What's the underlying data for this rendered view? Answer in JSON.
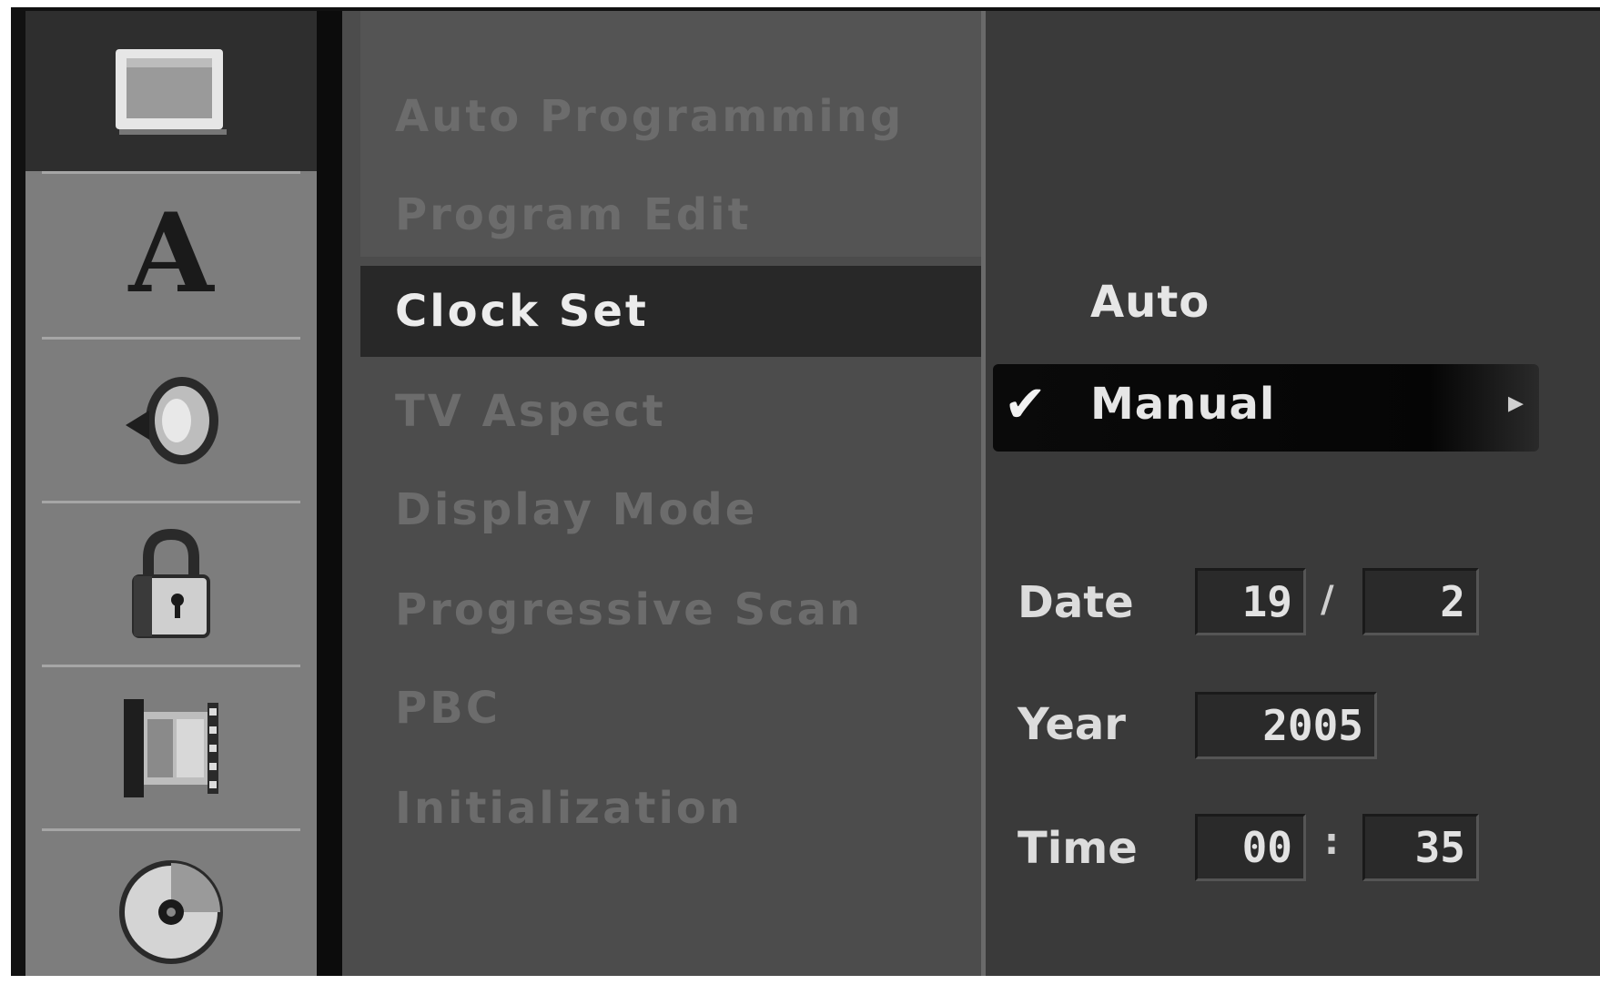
{
  "sidebar": {
    "icons": [
      {
        "name": "tv-screen-icon",
        "active": true
      },
      {
        "name": "language-icon"
      },
      {
        "name": "speaker-icon"
      },
      {
        "name": "lock-icon"
      },
      {
        "name": "film-icon"
      },
      {
        "name": "disc-icon"
      }
    ],
    "language_glyph": "A"
  },
  "menu": {
    "items": [
      "Auto Programming",
      "Program Edit",
      "Clock Set",
      "TV Aspect",
      "Display Mode",
      "Progressive Scan",
      "PBC",
      "Initialization"
    ],
    "selected": "Clock Set"
  },
  "submenu": {
    "options": [
      "Auto",
      "Manual"
    ],
    "checked": "Manual",
    "check_glyph": "✔",
    "arrow_glyph": "▸",
    "date_label": "Date",
    "date_day": "19",
    "date_sep": "/",
    "date_month": "2",
    "year_label": "Year",
    "year_value": "2005",
    "time_label": "Time",
    "time_hour": "00",
    "time_sep": ":",
    "time_minute": "35"
  }
}
